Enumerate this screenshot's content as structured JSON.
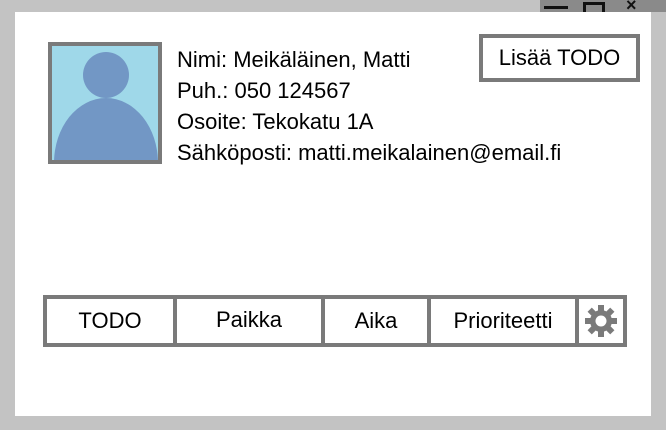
{
  "window": {
    "controls": {
      "minimize_icon": "minimize-icon",
      "maximize_icon": "maximize-icon",
      "close_icon": "close-icon"
    }
  },
  "profile": {
    "name_line": "Nimi: Meikäläinen, Matti",
    "phone_line": "Puh.: 050 124567",
    "address_line": "Osoite: Tekokatu 1A",
    "email_line": "Sähköposti: matti.meikalainen@email.fi"
  },
  "actions": {
    "add_todo_label": "Lisää TODO"
  },
  "table_header": {
    "columns": [
      "TODO",
      "Paikka",
      "Aika",
      "Prioriteetti"
    ],
    "settings_icon": "gear-icon"
  },
  "colors": {
    "background": "#c3c3c3",
    "panel": "#ffffff",
    "border": "#7a7a7a",
    "avatar_bg": "#9fd8e9",
    "avatar_figure": "#7297c5"
  }
}
